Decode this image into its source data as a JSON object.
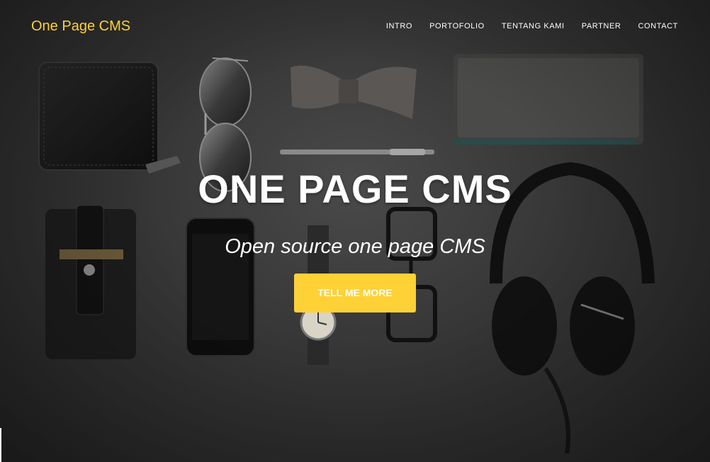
{
  "navbar": {
    "brand": "One Page CMS",
    "menu": [
      {
        "label": "INTRO"
      },
      {
        "label": "PORTOFOLIO"
      },
      {
        "label": "TENTANG KAMI"
      },
      {
        "label": "PARTNER"
      },
      {
        "label": "CONTACT"
      }
    ]
  },
  "hero": {
    "title": "ONE PAGE CMS",
    "subtitle": "Open source one page CMS",
    "button_label": "TELL ME MORE"
  },
  "colors": {
    "accent": "#fed136",
    "text": "#ffffff",
    "background": "#2f2f2f"
  },
  "background_image": {
    "items": [
      "wallet-icon",
      "sunglasses-icon",
      "bow-tie-icon",
      "notebook-icon",
      "pen-icon",
      "card-holder-icon",
      "smartphone-icon",
      "wristwatch-icon",
      "eyeglasses-icon",
      "headphones-icon"
    ]
  }
}
